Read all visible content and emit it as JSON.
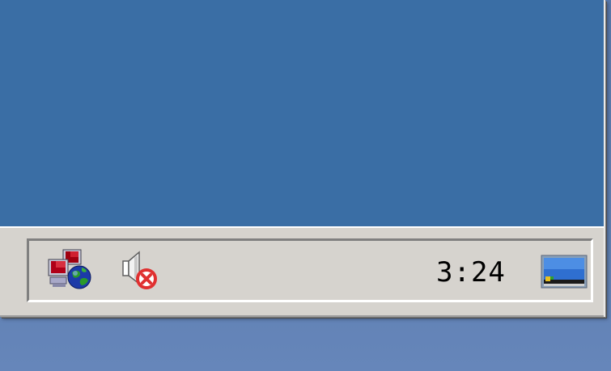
{
  "taskbar": {
    "clock": "3:24",
    "tray_icons": [
      {
        "name": "network-connections-icon"
      },
      {
        "name": "volume-muted-icon"
      },
      {
        "name": "display-icon"
      }
    ]
  },
  "colors": {
    "desktop": "#3a6ea5",
    "face": "#d6d3ce",
    "background": "#5d7eb0"
  }
}
